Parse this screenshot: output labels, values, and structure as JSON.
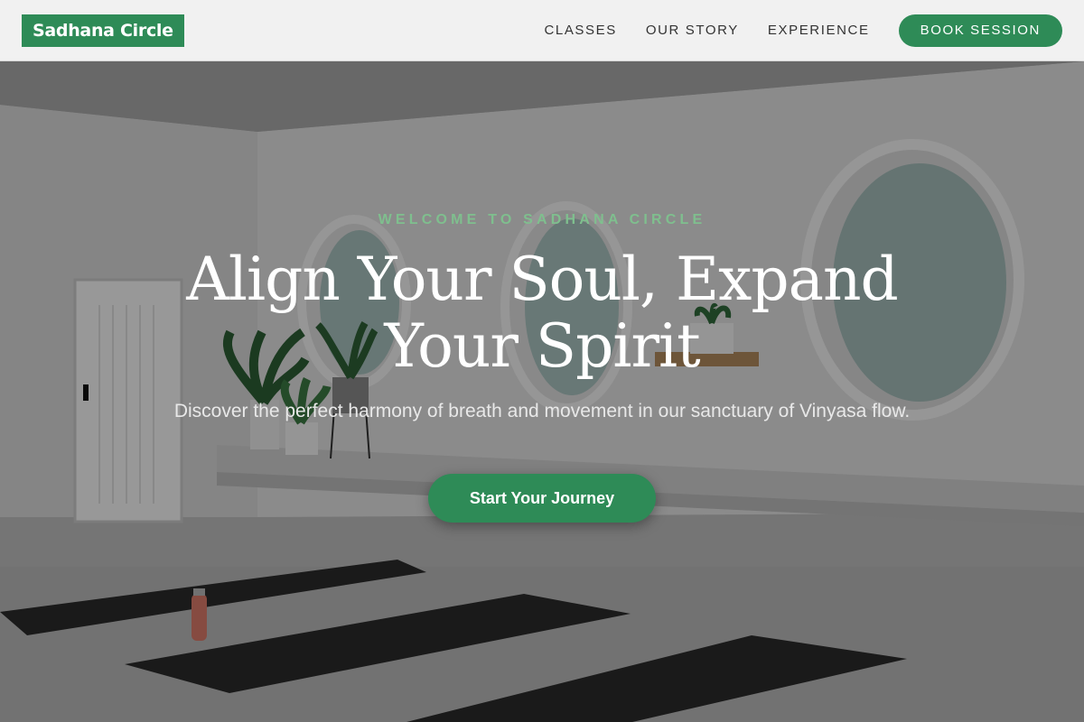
{
  "brand": {
    "name": "Sadhana Circle",
    "color": "#2e8b57"
  },
  "nav": {
    "links": [
      "CLASSES",
      "OUR STORY",
      "EXPERIENCE"
    ],
    "cta_label": "BOOK SESSION"
  },
  "hero": {
    "eyebrow": "WELCOME TO SADHANA CIRCLE",
    "headline_line1": "Align Your Soul, Expand",
    "headline_line2": "Your Spirit",
    "subtext": "Discover the perfect harmony of breath and movement in our sanctuary of Vinyasa flow.",
    "cta_label": "Start Your Journey"
  },
  "colors": {
    "accent": "#2e8b57",
    "eyebrow": "#7fbf8e",
    "header_bg": "#f1f1f1"
  }
}
